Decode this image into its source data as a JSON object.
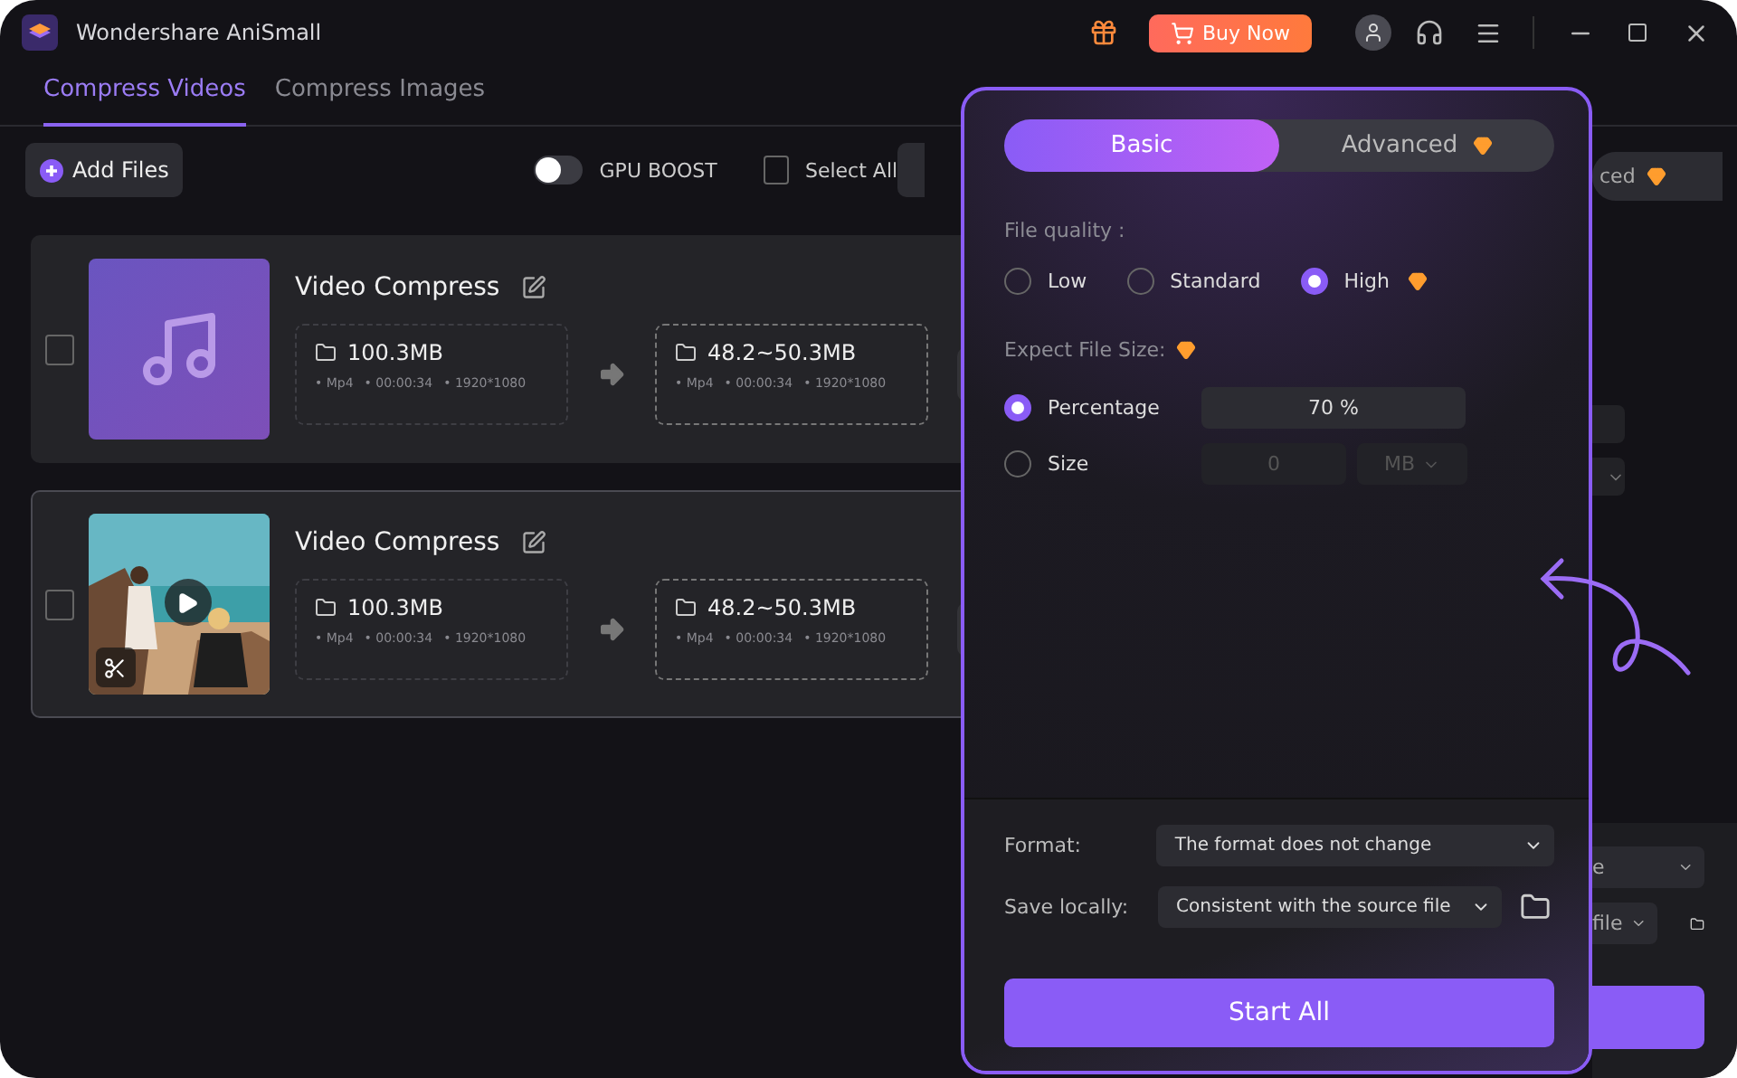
{
  "window": {
    "title": "Wondershare AniSmall"
  },
  "header": {
    "buy_button": "Buy Now"
  },
  "tabs": [
    {
      "label": "Compress Videos",
      "selected": true
    },
    {
      "label": "Compress Images",
      "selected": false
    }
  ],
  "toolbar": {
    "add_files": "Add Files",
    "gpu_boost": {
      "label": "GPU BOOST",
      "on": false
    },
    "select_all": {
      "label": "Select All",
      "checked": false
    }
  },
  "files": [
    {
      "title": "Video Compress",
      "kind": "audio",
      "checked": false,
      "hovered": false,
      "source": {
        "size": "100.3MB",
        "meta": [
          "• Mp4",
          "• 00:00:34",
          "• 1920*1080"
        ]
      },
      "target": {
        "size": "48.2~50.3MB",
        "meta": [
          "• Mp4",
          "• 00:00:34",
          "• 1920*1080"
        ]
      }
    },
    {
      "title": "Video Compress",
      "kind": "video",
      "checked": false,
      "hovered": true,
      "source": {
        "size": "100.3MB",
        "meta": [
          "• Mp4",
          "• 00:00:34",
          "• 1920*1080"
        ]
      },
      "target": {
        "size": "48.2~50.3MB",
        "meta": [
          "• Mp4",
          "• 00:00:34",
          "• 1920*1080"
        ]
      }
    }
  ],
  "right_strip": {
    "advanced_tab": "ced",
    "format_value": "e",
    "save_value": "file"
  },
  "settings_panel": {
    "tabs": [
      {
        "label": "Basic",
        "selected": true,
        "premium": false
      },
      {
        "label": "Advanced",
        "selected": false,
        "premium": true
      }
    ],
    "file_quality_label": "File quality :",
    "quality_options": [
      {
        "label": "Low",
        "selected": false,
        "premium": false
      },
      {
        "label": "Standard",
        "selected": false,
        "premium": false
      },
      {
        "label": "High",
        "selected": true,
        "premium": true
      }
    ],
    "expect_size_label": "Expect File Size:",
    "expect_size_premium": true,
    "size_modes": [
      {
        "kind": "percentage",
        "label": "Percentage",
        "selected": true,
        "value": "70 %"
      },
      {
        "kind": "size",
        "label": "Size",
        "selected": false,
        "value": "0",
        "unit": "MB"
      }
    ],
    "format": {
      "label": "Format:",
      "value": "The format does not change"
    },
    "save": {
      "label": "Save locally:",
      "value": "Consistent with the source file"
    },
    "start_button": "Start All"
  }
}
